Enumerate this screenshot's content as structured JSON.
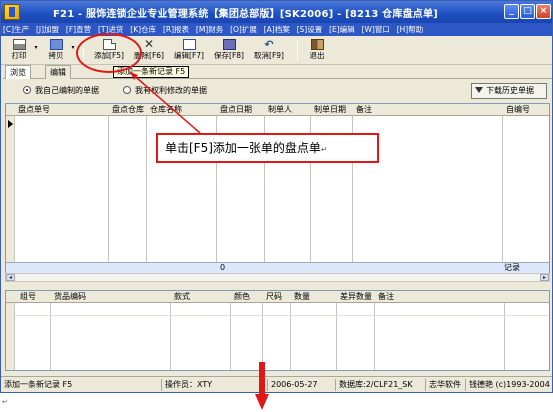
{
  "window": {
    "title": "F21 - 服饰连锁企业专业管理系统【集团总部版】[SK2006] - [8213 仓库盘点单]",
    "controls": [
      "_",
      "□",
      "×"
    ]
  },
  "menu": [
    "[C]生产",
    "[J]加盟",
    "[F]直营",
    "[T]进货",
    "[K]仓库",
    "[R]报表",
    "[M]财务",
    "[O]扩展",
    "[A]档案",
    "[S]设置",
    "[E]编辑",
    "[W]窗口",
    "[H]帮助"
  ],
  "toolbar": {
    "print": "打印",
    "copy": "拷贝",
    "add": "添加[F5]",
    "delete": "删除[F6]",
    "edit": "编辑[F7]",
    "save": "保存[F8]",
    "cancel": "取消[F9]",
    "exit": "退出"
  },
  "tooltip": "添加一条新记录  F5",
  "tabs": {
    "browse": "浏览",
    "edit": "编辑"
  },
  "filter": {
    "option_mine": "我自己编制的单据",
    "option_editable": "我有权利修改的单据",
    "history_button": "下载历史单据"
  },
  "master_grid": {
    "columns": [
      "盘点单号",
      "盘点仓库",
      "仓库名称",
      "盘点日期",
      "制单人",
      "制单日期",
      "备注",
      "自编号"
    ],
    "footer_value": "0",
    "footer_label": "记录"
  },
  "detail_grid": {
    "columns": [
      "组号",
      "货品编码",
      "款式",
      "颜色",
      "尺码",
      "数量",
      "差异数量",
      "备注"
    ]
  },
  "callout": "单击[F5]添加一张单的盘点单",
  "callout_mark": "↵",
  "statusbar": {
    "message": "添加一条新记录  F5",
    "operator": "操作员：XTY",
    "date": "2006-05-27",
    "database": "数据库:2/CLF21_SK",
    "company": "志华软件",
    "author": "钱德艳 (c)1993-2004"
  },
  "footnote": "↵",
  "colors": {
    "titlebar": "#1d4fc1",
    "menubar": "#2d57c4",
    "annotation": "#e01818",
    "grid_footer": "#dde7fb"
  }
}
